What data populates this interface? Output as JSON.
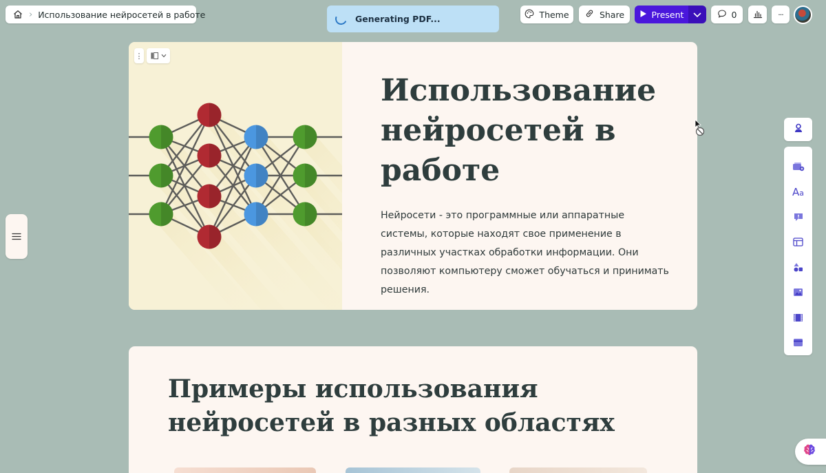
{
  "breadcrumb": {
    "home_icon": "home-icon",
    "separator": "›",
    "doc_title": "Использование нейросетей в работе"
  },
  "toast": {
    "message": "Generating PDF..."
  },
  "toolbar": {
    "theme_label": "Theme",
    "share_label": "Share",
    "present_label": "Present",
    "comments_count": "0",
    "more_label": "···"
  },
  "colors": {
    "background": "#a9bcb5",
    "card": "#fdf6f1",
    "accent_panel": "#f7f1d6",
    "present": "#4a17dc",
    "toast": "#bde0f6",
    "node_green": "#4f9b2e",
    "node_red": "#b02a32",
    "node_blue": "#4b97e0"
  },
  "card1": {
    "title": "Использование нейросетей в работе",
    "body": "Нейросети - это программные или аппаратные системы, которые находят свое применение в различных участках обработки информации. Они позволяют компьютеру сможет обучаться и принимать решения.",
    "image_icon": "neural-network-illustration"
  },
  "card2": {
    "title": "Примеры использования нейросетей в разных областях"
  },
  "right_rail": {
    "items": [
      "card-template-icon",
      "text-style-icon",
      "callout-icon",
      "layout-icon",
      "shapes-icon",
      "image-icon",
      "video-icon",
      "embed-icon"
    ]
  }
}
